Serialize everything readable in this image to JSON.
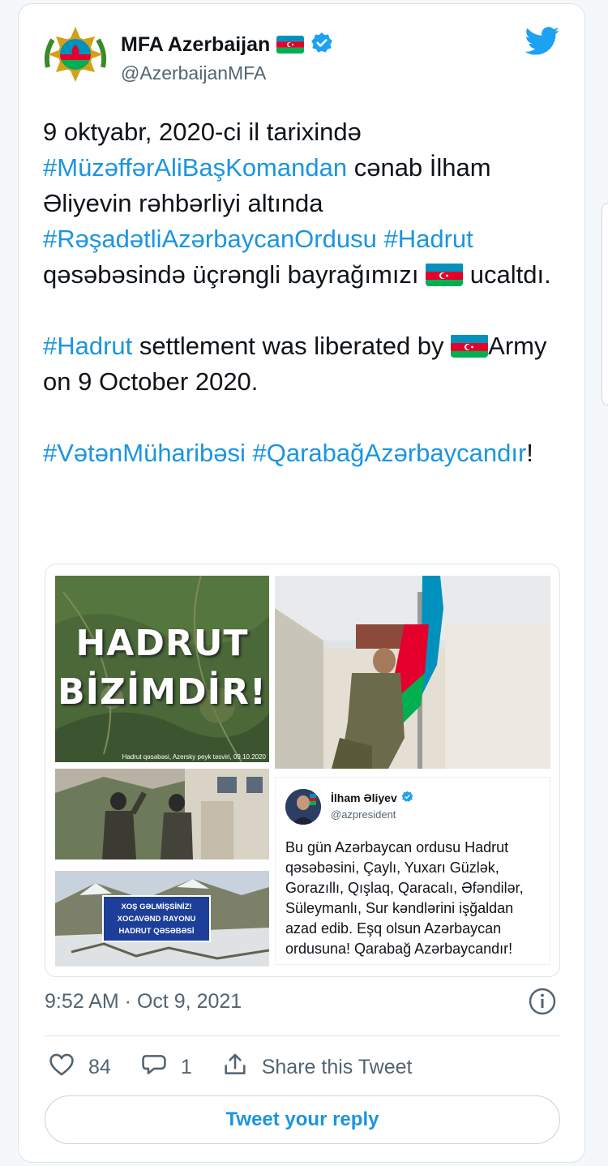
{
  "author": {
    "name": "MFA Azerbaijan",
    "handle": "@AzerbaijanMFA",
    "verified": true
  },
  "tweet": {
    "paragraphs": [
      [
        {
          "t": "9 oktyabr, 2020-ci il tarixində "
        },
        {
          "t": "#MüzəffərAliBaşKomandan",
          "tag": true
        },
        {
          "t": " cənab İlham Əliyevin rəhbərliyi altında "
        },
        {
          "t": "#RəşadətliAzərbaycanOrdusu",
          "tag": true
        },
        {
          "t": " "
        },
        {
          "t": "#Hadrut",
          "tag": true
        },
        {
          "t": " qəsəbəsində üçrəngli bayrağımızı "
        },
        {
          "flag": true
        },
        {
          "t": " ucaltdı."
        }
      ],
      [
        {
          "t": "#Hadrut",
          "tag": true
        },
        {
          "t": " settlement was liberated by "
        },
        {
          "flag": true
        },
        {
          "t": "Army on 9 October 2020."
        }
      ],
      [
        {
          "t": "#VətənMüharibəsi",
          "tag": true
        },
        {
          "t": " "
        },
        {
          "t": "#QarabağAzərbaycandır",
          "tag": true
        },
        {
          "t": "!"
        }
      ]
    ]
  },
  "media": {
    "hadrut_image": {
      "line1": "HADRUT",
      "line2": "BİZİMDİR!",
      "caption": "Hadrut qəsəbəsi, Azersky peyk təsviri, 09.10.2020"
    },
    "sign_image": {
      "line1": "XOŞ GƏLMİŞSİNİZ!",
      "line2": "XOCAVƏND RAYONU",
      "line3": "HADRUT QƏSƏBƏSİ"
    },
    "quoted_tweet": {
      "name": "İlham Əliyev",
      "handle": "@azpresident",
      "verified": true,
      "text": "Bu gün Azərbaycan ordusu Hadrut qəsəbəsini, Çaylı, Yuxarı Güzlək, Gorazıllı, Qışlaq, Qaracalı, Əfəndilər, Süleymanlı, Sur kəndlərini işğaldan azad edib. Eşq olsun Azərbaycan ordusuna! Qarabağ Azərbaycandır!"
    }
  },
  "meta": {
    "timestamp": "9:52 AM · Oct 9, 2021"
  },
  "actions": {
    "likes": "84",
    "replies": "1",
    "share_label": "Share this Tweet",
    "reply_button": "Tweet your reply"
  },
  "colors": {
    "link": "#1b95e0",
    "flag_blue": "#0092bc",
    "flag_red": "#e4002b",
    "flag_green": "#00af50",
    "verified": "#1da1f2"
  }
}
